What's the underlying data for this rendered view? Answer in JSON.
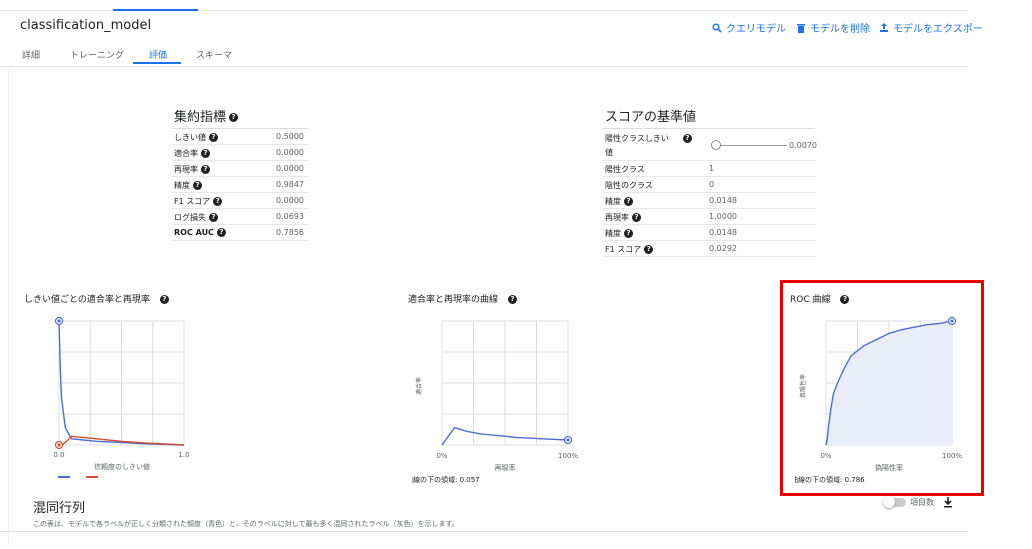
{
  "header": {
    "title": "classification_model",
    "actions": [
      {
        "icon": "search-icon",
        "label": "クエリモデル"
      },
      {
        "icon": "delete-icon",
        "label": "モデルを削除"
      },
      {
        "icon": "export-icon",
        "label": "モデルをエクスポー"
      }
    ]
  },
  "tabs": [
    {
      "label": "詳細",
      "active": false
    },
    {
      "label": "トレーニング",
      "active": false
    },
    {
      "label": "評価",
      "active": true
    },
    {
      "label": "スキーマ",
      "active": false
    }
  ],
  "aggregate": {
    "title": "集約指標",
    "rows": [
      {
        "label": "しきい値",
        "value": "0.5000"
      },
      {
        "label": "適合率",
        "value": "0.0000"
      },
      {
        "label": "再現率",
        "value": "0.0000"
      },
      {
        "label": "精度",
        "value": "0.9847"
      },
      {
        "label": "F1 スコア",
        "value": "0.0000"
      },
      {
        "label": "ログ損失",
        "value": "0.0693"
      },
      {
        "label": "ROC AUC",
        "value": "0.7856"
      }
    ]
  },
  "score": {
    "title": "スコアの基準値",
    "threshold_label_1": "陽性クラスしきい",
    "threshold_label_2": "値",
    "threshold_value": "0.0070",
    "threshold_slider_fraction": 0.0,
    "rows": [
      {
        "label": "陽性クラス",
        "value": "1",
        "help": false
      },
      {
        "label": "陰性のクラス",
        "value": "0",
        "help": false
      },
      {
        "label": "精度",
        "value": "0.0148",
        "help": true
      },
      {
        "label": "再現率",
        "value": "1.0000",
        "help": true
      },
      {
        "label": "精度",
        "value": "0.0148",
        "help": true
      },
      {
        "label": "F1 スコア",
        "value": "0.0292",
        "help": true
      }
    ]
  },
  "charts": {
    "pr_threshold": {
      "title": "しきい値ごとの適合率と再現率",
      "x_start": "0.0",
      "x_end": "1.0",
      "xlabel": "信頼度のしきい値",
      "series_colors": [
        "#4a6fd6",
        "#d84b2a"
      ]
    },
    "pr_curve": {
      "title": "適合率と再現率の曲線",
      "ylabel": "適合率",
      "xlabel": "再現率",
      "x_start": "0%",
      "x_end": "100%",
      "auc_note": "曲線の下の領域: 0.057"
    },
    "roc": {
      "title": "ROC 曲線",
      "ylabel": "真陽性率",
      "xlabel": "偽陽性率",
      "x_start": "0%",
      "x_end": "100%",
      "auc_note": "曲線の下の領域: 0.786"
    }
  },
  "chart_data": [
    {
      "type": "line",
      "x": [
        0,
        0.01,
        0.02,
        0.05,
        0.1,
        0.3,
        0.5,
        0.7,
        1.0
      ],
      "series": [
        {
          "values": [
            1.0,
            0.62,
            0.38,
            0.14,
            0.05,
            0.03,
            0.02,
            0.01,
            0.0
          ]
        },
        {
          "values": [
            0.0,
            0.0,
            0.0,
            0.02,
            0.07,
            0.05,
            0.03,
            0.015,
            0.0
          ]
        }
      ],
      "title": "しきい値ごとの適合率と再現率",
      "xlabel": "信頼度のしきい値",
      "xlim": [
        0,
        1
      ],
      "ylim": [
        0,
        1
      ],
      "grid": true
    },
    {
      "type": "line",
      "x": [
        0,
        0.1,
        0.2,
        0.3,
        0.4,
        0.5,
        0.6,
        0.7,
        0.8,
        0.9,
        1.0
      ],
      "y": [
        0.0,
        0.14,
        0.11,
        0.09,
        0.08,
        0.07,
        0.06,
        0.055,
        0.05,
        0.045,
        0.04
      ],
      "title": "適合率と再現率の曲線",
      "xlabel": "再現率",
      "ylabel": "適合率",
      "xlim": [
        0,
        1
      ],
      "ylim": [
        0,
        1
      ],
      "grid": true
    },
    {
      "type": "area",
      "x": [
        0,
        0.01,
        0.02,
        0.04,
        0.06,
        0.1,
        0.15,
        0.2,
        0.3,
        0.4,
        0.5,
        0.6,
        0.7,
        0.8,
        0.9,
        1.0
      ],
      "y": [
        0,
        0.05,
        0.15,
        0.3,
        0.42,
        0.52,
        0.63,
        0.72,
        0.8,
        0.85,
        0.9,
        0.93,
        0.95,
        0.97,
        0.98,
        1.0
      ],
      "title": "ROC 曲線",
      "xlabel": "偽陽性率",
      "ylabel": "真陽性率",
      "xlim": [
        0,
        1
      ],
      "ylim": [
        0,
        1
      ],
      "grid": true
    }
  ],
  "confusion": {
    "title": "混同行列",
    "description": "この表は、モデルで各ラベルが正しく分類された頻度（青色）と、そのラベルに対して最も多く混同されたラベル（灰色）を示します。",
    "toggle_label": "項目数"
  }
}
